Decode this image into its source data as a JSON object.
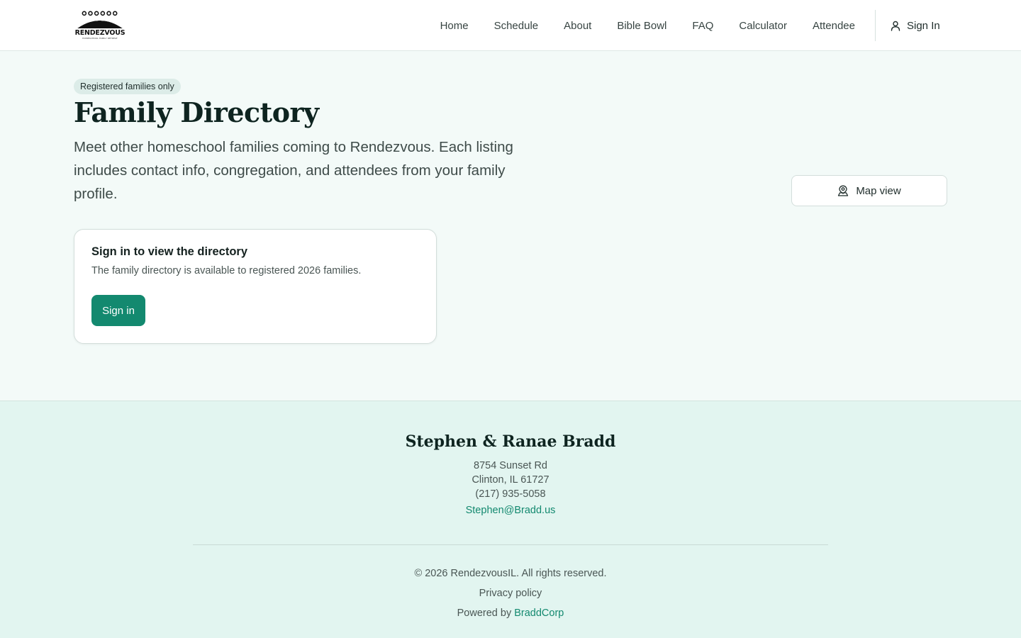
{
  "header": {
    "logo_text": "RENDEZVOUS",
    "logo_subtext": "HOMESCHOOL FAMILY RETREAT",
    "nav": [
      {
        "label": "Home"
      },
      {
        "label": "Schedule"
      },
      {
        "label": "About"
      },
      {
        "label": "Bible Bowl"
      },
      {
        "label": "FAQ"
      },
      {
        "label": "Calculator"
      },
      {
        "label": "Attendee"
      }
    ],
    "sign_in_label": "Sign In"
  },
  "main": {
    "badge": "Registered families only",
    "title": "Family Directory",
    "description": "Meet other homeschool families coming to Rendezvous. Each listing includes contact info, congregation, and attendees from your family profile.",
    "map_view_label": "Map view",
    "card": {
      "title": "Sign in to view the directory",
      "text": "The family directory is available to registered 2026 families.",
      "button_label": "Sign in"
    }
  },
  "footer": {
    "name": "Stephen & Ranae Bradd",
    "address_line1": "8754 Sunset Rd",
    "address_line2": "Clinton, IL 61727",
    "phone": "(217) 935-5058",
    "email": "Stephen@Bradd.us",
    "copyright": "© 2026 RendezvousIL. All rights reserved.",
    "privacy_label": "Privacy policy",
    "powered_by_prefix": "Powered by ",
    "powered_by_brand": "BraddCorp"
  },
  "colors": {
    "accent": "#13896f",
    "page_background": "#f3faf8",
    "footer_background": "#e2f5f0",
    "heading": "#0e2420"
  },
  "icons": {
    "sign_in": "user-icon",
    "map_view": "map-pin-person-icon"
  }
}
